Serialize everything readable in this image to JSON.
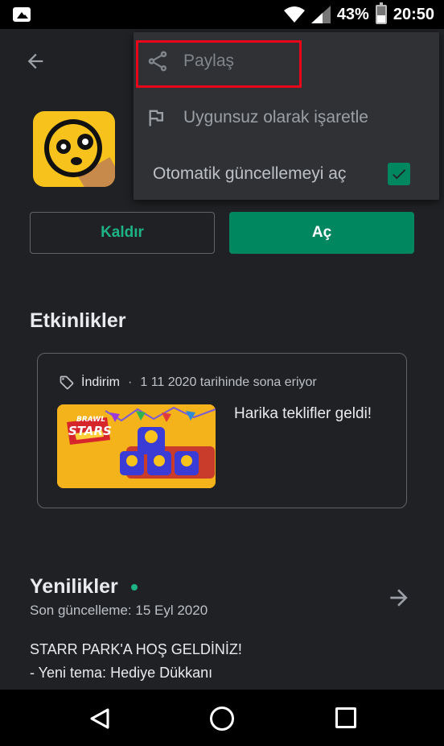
{
  "status_bar": {
    "battery": "43%",
    "battery_level": 0.43,
    "time": "20:50"
  },
  "actions": {
    "uninstall_label": "Kaldır",
    "open_label": "Aç"
  },
  "events": {
    "title": "Etkinlikler",
    "card": {
      "tag": "İndirim",
      "separator": "·",
      "ends": "1 11 2020 tarihinde sona eriyor",
      "promo_logo_top": "BRAWL",
      "promo_logo_bottom": "STARS",
      "text": "Harika teklifler geldi!"
    }
  },
  "whats_new": {
    "title": "Yenilikler",
    "updated": "Son güncelleme: 15 Eyl 2020",
    "lines": [
      "STARR PARK'A HOŞ GELDİNİZ!",
      "- Yeni tema: Hediye Dükkanı"
    ]
  },
  "menu": {
    "items": [
      {
        "label": "Paylaş",
        "icon": "share-icon"
      },
      {
        "label": "Uygunsuz olarak işaretle",
        "icon": "flag-icon"
      },
      {
        "label": "Otomatik güncellemeyi aç",
        "checked": true
      }
    ]
  },
  "colors": {
    "accent": "#01875f",
    "highlight": "#e8071a",
    "background": "#202124",
    "menu_bg": "#303134"
  }
}
